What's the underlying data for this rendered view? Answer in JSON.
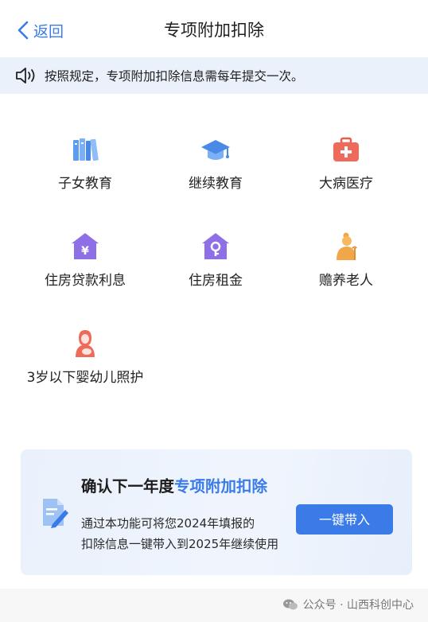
{
  "nav": {
    "back_label": "返回",
    "title": "专项附加扣除"
  },
  "notice": {
    "icon": "speaker-icon",
    "text": "按照规定，专项附加扣除信息需每年提交一次。"
  },
  "items": [
    {
      "label": "子女教育",
      "icon": "books-icon"
    },
    {
      "label": "继续教育",
      "icon": "graduation-cap-icon"
    },
    {
      "label": "大病医疗",
      "icon": "medical-kit-icon"
    },
    {
      "label": "住房贷款利息",
      "icon": "house-loan-icon"
    },
    {
      "label": "住房租金",
      "icon": "house-key-icon"
    },
    {
      "label": "赡养老人",
      "icon": "elderly-icon"
    },
    {
      "label": "3岁以下婴幼儿照护",
      "icon": "mother-infant-icon"
    }
  ],
  "card": {
    "heading_prefix": "确认下一年度",
    "heading_highlight": "专项附加扣除",
    "desc_line1": "通过本功能可将您2024年填报的",
    "desc_line2": "扣除信息一键带入到2025年继续使用",
    "button_label": "一键带入",
    "icon": "document-pen-icon"
  },
  "watermark": {
    "text": "公众号 · 山西科创中心",
    "icon": "wechat-icon"
  },
  "colors": {
    "accent": "#3a7be8",
    "notice_bg": "#eaf1fb"
  }
}
